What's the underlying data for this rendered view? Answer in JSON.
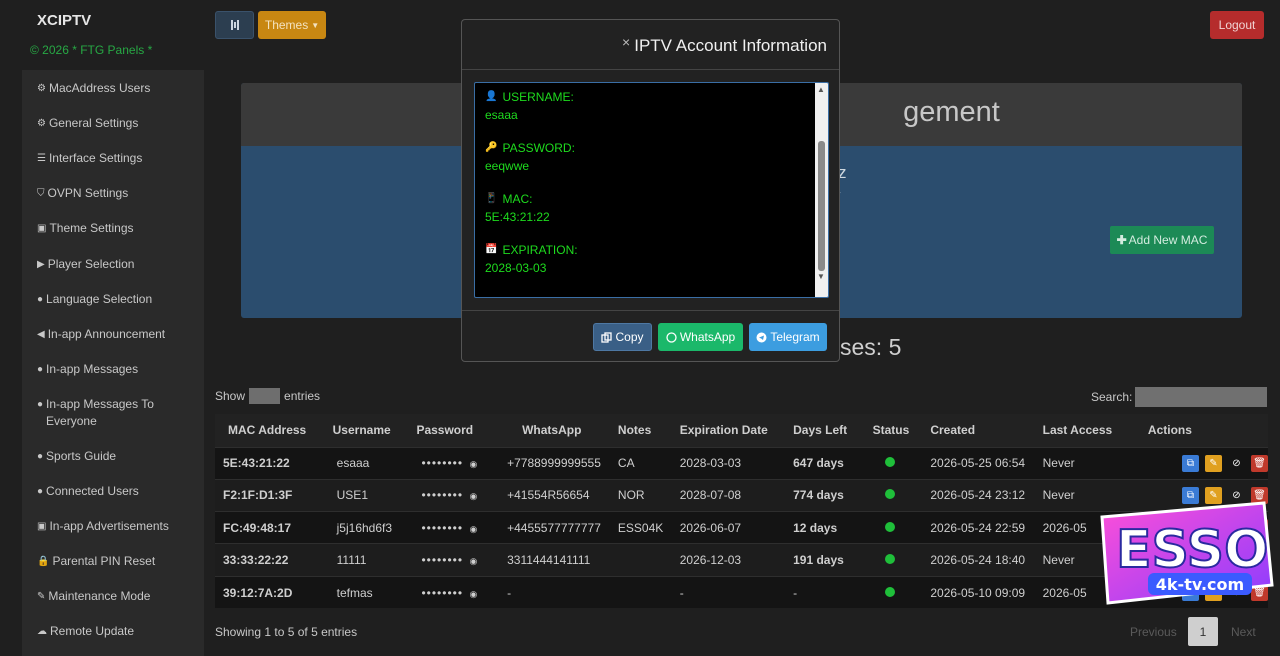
{
  "brand": {
    "name": "XCIPTV",
    "copyright": "© 2026 * FTG Panels *"
  },
  "sidebar": {
    "items": [
      {
        "label": "MacAddress Users",
        "icon": "gears-icon"
      },
      {
        "label": "General Settings",
        "icon": "gears-icon"
      },
      {
        "label": "Interface Settings",
        "icon": "sliders-icon"
      },
      {
        "label": "OVPN Settings",
        "icon": "shield-icon"
      },
      {
        "label": "Theme Settings",
        "icon": "image-icon"
      },
      {
        "label": "Player Selection",
        "icon": "play-icon"
      },
      {
        "label": "Language Selection",
        "icon": "globe-icon"
      },
      {
        "label": "In-app Announcement",
        "icon": "bullhorn-icon"
      },
      {
        "label": "In-app Messages",
        "icon": "comment-icon"
      },
      {
        "label": "In-app Messages To Everyone",
        "icon": "comment-icon"
      },
      {
        "label": "Sports Guide",
        "icon": "comment-icon"
      },
      {
        "label": "Connected Users",
        "icon": "comment-icon"
      },
      {
        "label": "In-app Advertisements",
        "icon": "ad-icon"
      },
      {
        "label": "Parental PIN Reset",
        "icon": "lock-icon"
      },
      {
        "label": "Maintenance Mode",
        "icon": "wrench-icon"
      },
      {
        "label": "Remote Update",
        "icon": "cloud-icon"
      }
    ]
  },
  "header": {
    "themes_label": "Themes",
    "logout_label": "Logout"
  },
  "panel": {
    "title_visible": "gement",
    "subtitle_visible": "xyz",
    "add_mac_label": "Add New MAC"
  },
  "licenses_text": "ses: 5",
  "table_controls": {
    "show": "Show",
    "entries": "entries",
    "search_label": "Search:"
  },
  "table": {
    "columns": [
      "MAC Address",
      "Username",
      "Password",
      "WhatsApp",
      "Notes",
      "Expiration Date",
      "Days Left",
      "Status",
      "Created",
      "Last Access",
      "Actions"
    ],
    "rows": [
      {
        "mac": "5E:43:21:22",
        "username": "esaaa",
        "password": "••••••••",
        "whatsapp": "+7788999999555",
        "notes": "CA",
        "expiration": "2028-03-03",
        "days_left": "647 days",
        "created": "2026-05-25 06:54",
        "last_access": "Never"
      },
      {
        "mac": "F2:1F:D1:3F",
        "username": "USE1",
        "password": "••••••••",
        "whatsapp": "+41554R56654",
        "notes": "NOR",
        "expiration": "2028-07-08",
        "days_left": "774 days",
        "created": "2026-05-24 23:12",
        "last_access": "Never"
      },
      {
        "mac": "FC:49:48:17",
        "username": "j5j16hd6f3",
        "password": "••••••••",
        "whatsapp": "+4455577777777",
        "notes": "ESS04K",
        "expiration": "2026-06-07",
        "days_left": "12 days",
        "created": "2026-05-24 22:59",
        "last_access": "2026-05"
      },
      {
        "mac": "33:33:22:22",
        "username": "11111",
        "password": "••••••••",
        "whatsapp": "3311444141111",
        "notes": "",
        "expiration": "2026-12-03",
        "days_left": "191 days",
        "created": "2026-05-24 18:40",
        "last_access": "Never"
      },
      {
        "mac": "39:12:7A:2D",
        "username": "tefmas",
        "password": "••••••••",
        "whatsapp": "-",
        "notes": "",
        "expiration": "-",
        "days_left": "-",
        "created": "2026-05-10 09:09",
        "last_access": "2026-05"
      }
    ]
  },
  "footer": {
    "showing": "Showing 1 to 5 of 5 entries",
    "previous": "Previous",
    "page": "1",
    "next": "Next"
  },
  "modal": {
    "title": "IPTV Account Information",
    "close": "×",
    "fields": [
      {
        "label": "USERNAME:",
        "value": "esaaa",
        "icon": "user-icon"
      },
      {
        "label": "PASSWORD:",
        "value": "eeqwwe",
        "icon": "key-icon"
      },
      {
        "label": "MAC:",
        "value": "5E:43:21:22",
        "icon": "device-icon"
      },
      {
        "label": "EXPIRATION:",
        "value": "2028-03-03",
        "icon": "calendar-icon"
      }
    ],
    "copy_label": "Copy",
    "whatsapp_label": "WhatsApp",
    "telegram_label": "Telegram"
  },
  "watermark": {
    "line1": "ESSO",
    "line2": "4k-tv.com"
  },
  "colors": {
    "accent_green": "#27a844",
    "days_orange": "#e0862a",
    "logout_red": "#b52c2c",
    "themes_orange": "#c88712"
  }
}
